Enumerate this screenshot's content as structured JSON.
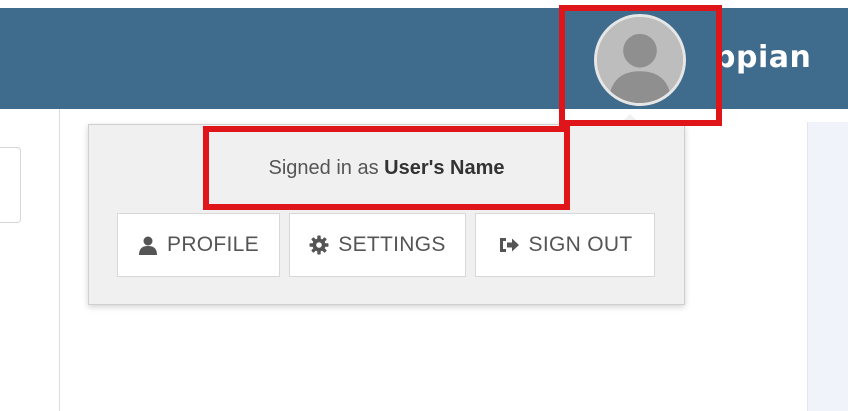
{
  "header": {
    "brand_text": "ppian",
    "avatar_icon": "user-avatar-icon",
    "bar_color": "#3f6b8c"
  },
  "user_menu": {
    "signed_in_prefix": "Signed in as",
    "user_name": "User's Name",
    "buttons": [
      {
        "label": "PROFILE",
        "icon": "user-icon"
      },
      {
        "label": "SETTINGS",
        "icon": "gear-icon"
      },
      {
        "label": "SIGN OUT",
        "icon": "sign-out-icon"
      }
    ]
  },
  "highlight_color": "#e0151a"
}
